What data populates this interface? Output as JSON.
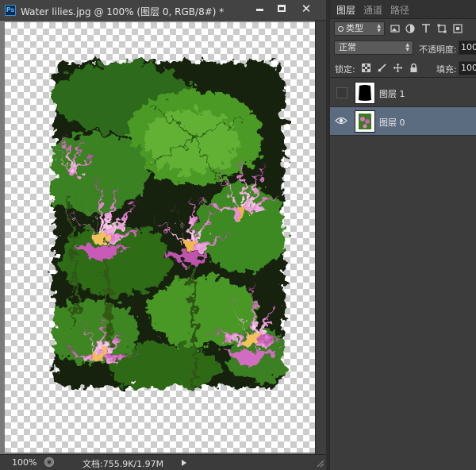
{
  "document": {
    "title": "Water lilies.jpg @ 100% (图层 0, RGB/8#) *",
    "app_logo_text": "Ps",
    "window_buttons": {
      "minimize": "minimize-icon",
      "maximize": "maximize-icon",
      "close": "✕"
    }
  },
  "status_bar": {
    "zoom": "100%",
    "doc_size": "文档:755.9K/1.97M"
  },
  "layers_panel": {
    "tabs": [
      {
        "label": "图层",
        "active": true
      },
      {
        "label": "通道",
        "active": false
      },
      {
        "label": "路径",
        "active": false
      }
    ],
    "filter": {
      "label": "类型",
      "icons": [
        "image-filter-icon",
        "adjustment-filter-icon",
        "type-filter-icon",
        "shape-filter-icon",
        "smart-object-filter-icon"
      ]
    },
    "blend_mode": "正常",
    "opacity_label": "不透明度:",
    "opacity_value": "100%",
    "lock_label": "锁定:",
    "lock_icons": [
      "lock-transparent-icon",
      "lock-paint-icon",
      "lock-move-icon",
      "lock-all-icon"
    ],
    "fill_label": "填充:",
    "fill_value": "100%",
    "layers": [
      {
        "name": "图层 1",
        "visible": false,
        "selected": false
      },
      {
        "name": "图层 0",
        "visible": true,
        "selected": true
      }
    ]
  },
  "colors": {
    "selected_layer": "#5b6b80",
    "panel_bg": "#3c3c3c",
    "ps_logo_blue": "#59b4ff"
  }
}
